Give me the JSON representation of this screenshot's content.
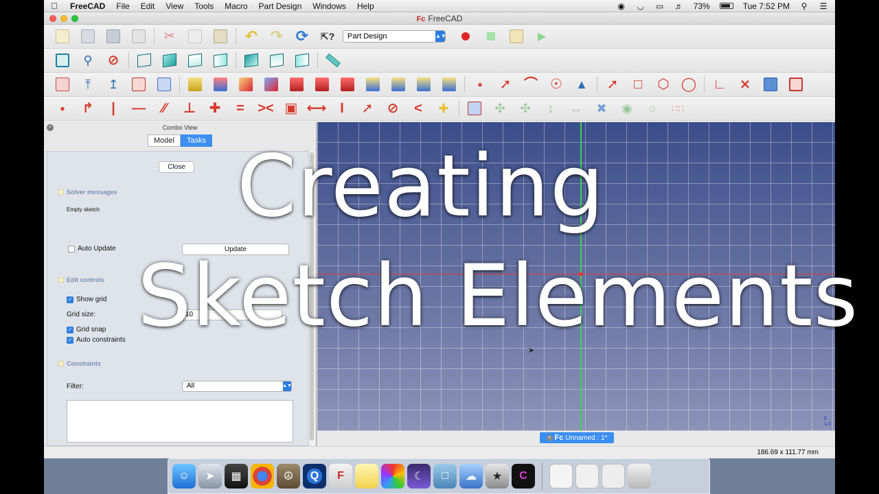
{
  "menubar": {
    "app_name": "FreeCAD",
    "items": [
      "File",
      "Edit",
      "View",
      "Tools",
      "Macro",
      "Part Design",
      "Windows",
      "Help"
    ],
    "battery": "73%",
    "clock": "Tue 7:52 PM"
  },
  "window": {
    "title": "FreeCAD"
  },
  "toolbar": {
    "workbench_selected": "Part Design"
  },
  "combo_view": {
    "title": "Combo View",
    "tabs": [
      {
        "label": "Model",
        "active": false
      },
      {
        "label": "Tasks",
        "active": true
      }
    ],
    "close_label": "Close",
    "solver_title": "Solver messages",
    "solver_message": "Empty sketch",
    "auto_update_label": "Auto Update",
    "auto_update_checked": false,
    "update_label": "Update",
    "edit_controls_title": "Edit controls",
    "show_grid_label": "Show grid",
    "show_grid_checked": true,
    "grid_size_label": "Grid size:",
    "grid_size_value": "10",
    "grid_snap_label": "Grid snap",
    "grid_snap_checked": true,
    "auto_constraints_label": "Auto constraints",
    "auto_constraints_checked": true,
    "constraints_title": "Constraints",
    "filter_label": "Filter:",
    "filter_value": "All"
  },
  "document_tab": {
    "label": "Unnamed : 1*"
  },
  "statusbar": {
    "dimensions": "186.69 x 111.77 mm"
  },
  "overlay": {
    "line1": "Creating",
    "line2": "Sketch Elements"
  },
  "colors": {
    "accent_blue": "#3d8ff0",
    "view_background_top": "#3b4d8a",
    "axis_green": "#3fd153",
    "axis_red": "#e23b3b",
    "sketcher_red": "#d63a2d"
  }
}
